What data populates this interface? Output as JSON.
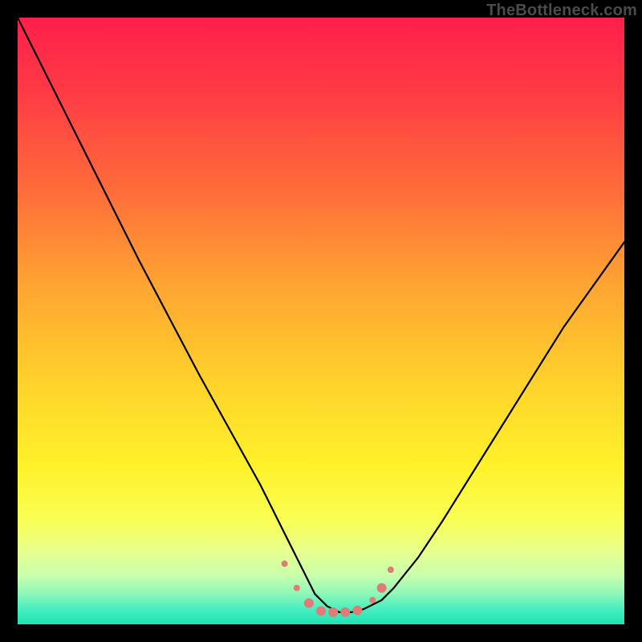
{
  "watermark": "TheBottleneck.com",
  "chart_data": {
    "type": "line",
    "title": "",
    "xlabel": "",
    "ylabel": "",
    "xlim": [
      0,
      100
    ],
    "ylim": [
      0,
      100
    ],
    "grid": false,
    "legend": false,
    "background": {
      "kind": "vertical-gradient",
      "stops": [
        {
          "pos": 0.0,
          "color": "#ff1f4a"
        },
        {
          "pos": 0.12,
          "color": "#ff3a45"
        },
        {
          "pos": 0.28,
          "color": "#ff6b3a"
        },
        {
          "pos": 0.44,
          "color": "#ffa432"
        },
        {
          "pos": 0.6,
          "color": "#ffd22b"
        },
        {
          "pos": 0.74,
          "color": "#fff22a"
        },
        {
          "pos": 0.83,
          "color": "#f8ff55"
        },
        {
          "pos": 0.88,
          "color": "#e7ff8e"
        },
        {
          "pos": 0.92,
          "color": "#c8ffad"
        },
        {
          "pos": 0.95,
          "color": "#8cf7b9"
        },
        {
          "pos": 0.975,
          "color": "#47eec0"
        },
        {
          "pos": 1.0,
          "color": "#1de3b2"
        }
      ]
    },
    "series": [
      {
        "name": "bottleneck-curve",
        "color": "#000000",
        "stroke_width": 2.2,
        "x": [
          0,
          5,
          10,
          15,
          20,
          25,
          30,
          35,
          40,
          44,
          47,
          49,
          51,
          53,
          55,
          57,
          60,
          62,
          66,
          70,
          75,
          80,
          85,
          90,
          95,
          100
        ],
        "y": [
          100,
          90,
          80,
          70,
          60,
          50.5,
          41,
          32,
          23,
          15,
          9,
          5,
          3,
          2,
          2,
          2.5,
          4,
          6,
          11,
          17,
          25,
          33,
          41,
          49,
          56,
          63
        ]
      }
    ],
    "markers": {
      "name": "minimum-region-markers",
      "color": "#e27b78",
      "radius_small": 4,
      "radius_large": 6,
      "points": [
        {
          "x": 44.0,
          "y": 10.0,
          "r": "small"
        },
        {
          "x": 46.0,
          "y": 6.0,
          "r": "small"
        },
        {
          "x": 48.0,
          "y": 3.5,
          "r": "large"
        },
        {
          "x": 50.0,
          "y": 2.2,
          "r": "large"
        },
        {
          "x": 52.0,
          "y": 2.0,
          "r": "large"
        },
        {
          "x": 54.0,
          "y": 2.0,
          "r": "large"
        },
        {
          "x": 56.0,
          "y": 2.3,
          "r": "large"
        },
        {
          "x": 58.5,
          "y": 4.0,
          "r": "small"
        },
        {
          "x": 60.0,
          "y": 6.0,
          "r": "large"
        },
        {
          "x": 61.5,
          "y": 9.0,
          "r": "small"
        }
      ]
    }
  }
}
